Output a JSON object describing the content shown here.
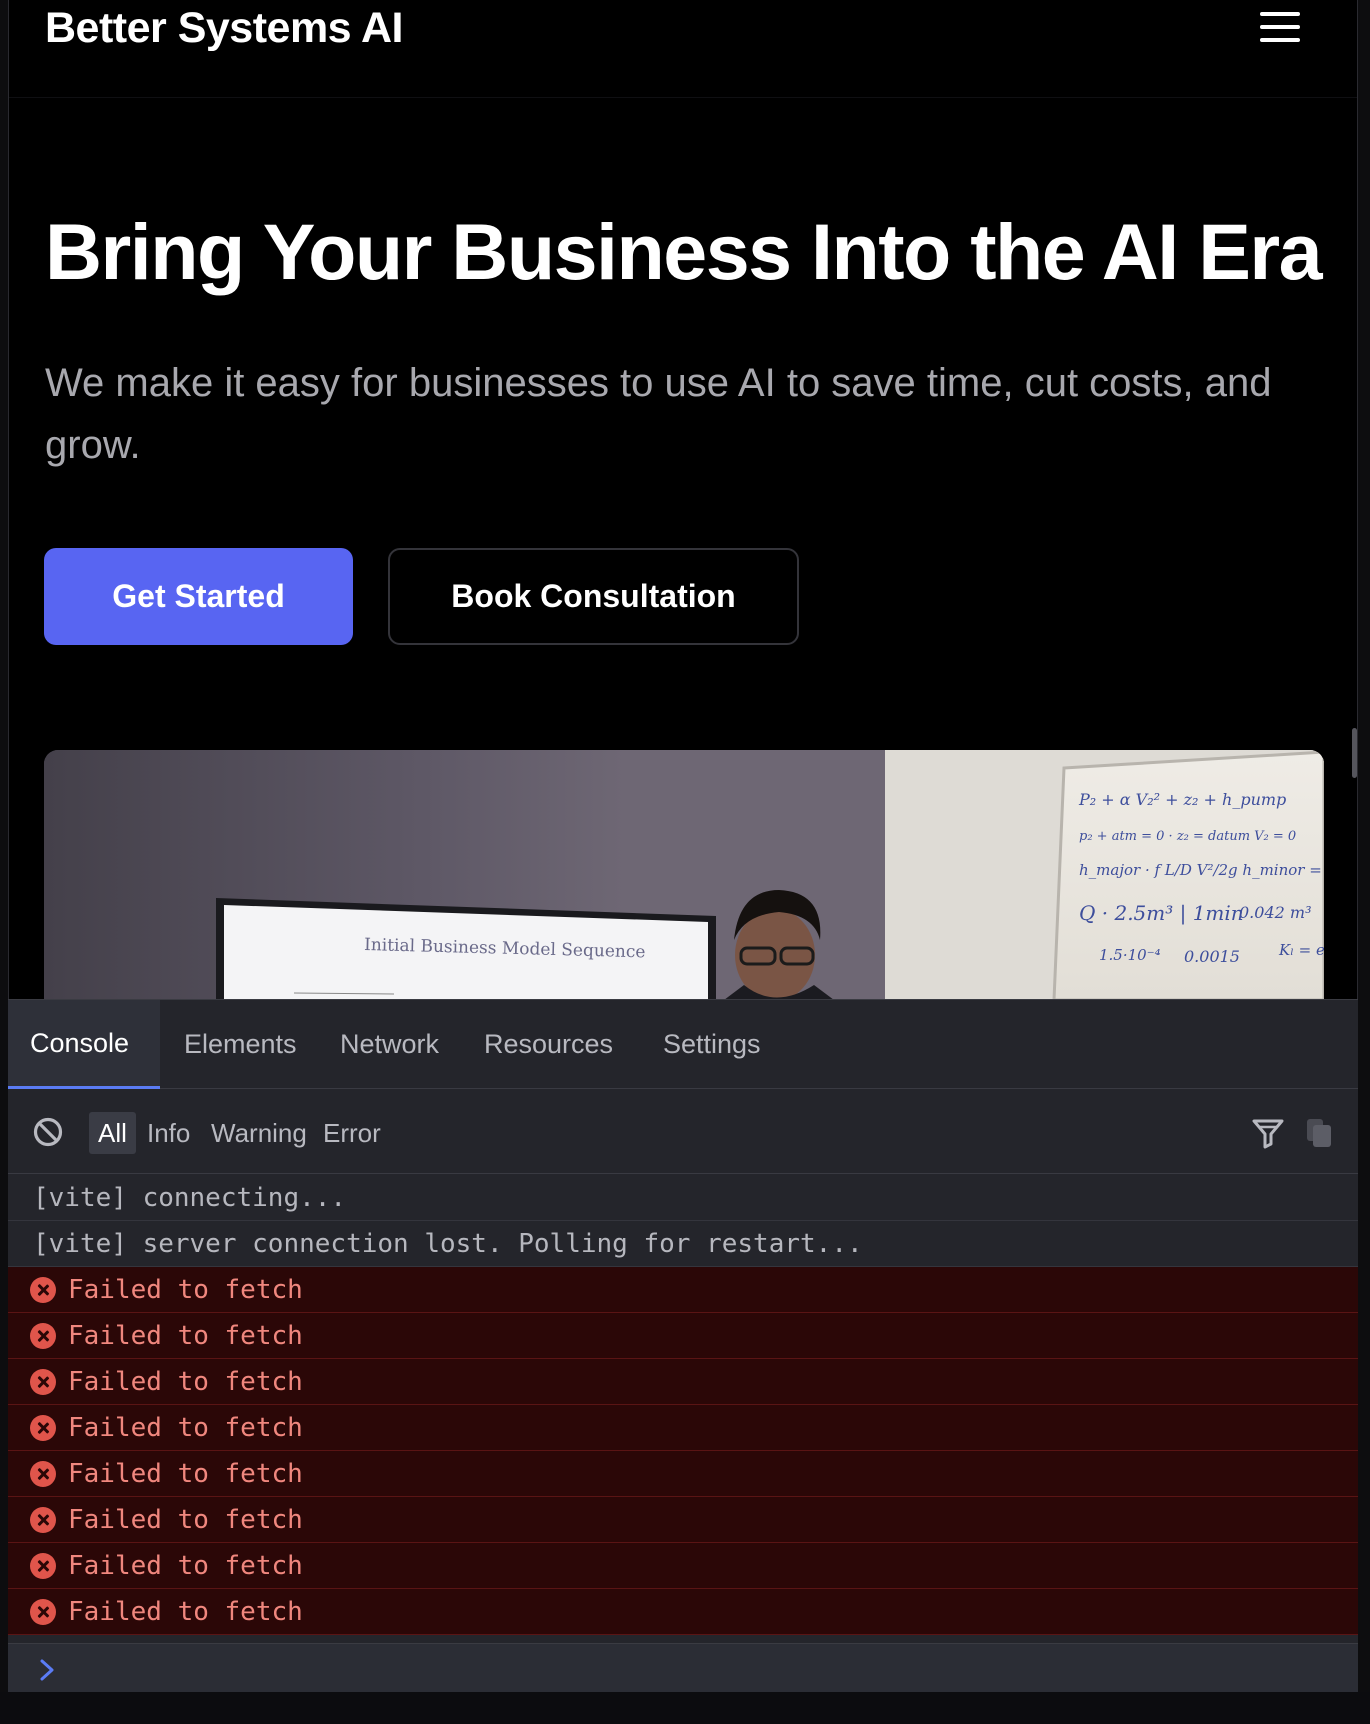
{
  "site": {
    "brand": "Better Systems AI",
    "menu_icon": "hamburger-icon"
  },
  "hero": {
    "title": "Bring Your Business Into the AI Era",
    "subtitle": "We make it easy for businesses to use AI to save time, cut costs, and grow.",
    "primary_button": "Get Started",
    "secondary_button": "Book Consultation",
    "accent_color": "#5865f2",
    "image": {
      "screen_text": "Initial Business Model Sequence",
      "whiteboard_text": [
        "0.042 m³",
        "0.0015",
        "1.5·10⁻⁴",
        "2.5m³"
      ]
    }
  },
  "devtools": {
    "tabs": [
      {
        "label": "Console",
        "active": true
      },
      {
        "label": "Elements",
        "active": false
      },
      {
        "label": "Network",
        "active": false
      },
      {
        "label": "Resources",
        "active": false
      },
      {
        "label": "Settings",
        "active": false
      }
    ],
    "filters": [
      {
        "label": "All",
        "active": true
      },
      {
        "label": "Info",
        "active": false
      },
      {
        "label": "Warning",
        "active": false
      },
      {
        "label": "Error",
        "active": false
      }
    ],
    "logs": [
      {
        "level": "info",
        "text": "[vite] connecting..."
      },
      {
        "level": "info",
        "text": "[vite] server connection lost. Polling for restart..."
      },
      {
        "level": "error",
        "text": "Failed to fetch"
      },
      {
        "level": "error",
        "text": "Failed to fetch"
      },
      {
        "level": "error",
        "text": "Failed to fetch"
      },
      {
        "level": "error",
        "text": "Failed to fetch"
      },
      {
        "level": "error",
        "text": "Failed to fetch"
      },
      {
        "level": "error",
        "text": "Failed to fetch"
      },
      {
        "level": "error",
        "text": "Failed to fetch"
      },
      {
        "level": "error",
        "text": "Failed to fetch"
      }
    ],
    "prompt_value": "",
    "icons": {
      "clear": "clear-console-icon",
      "filter": "filter-funnel-icon",
      "copy": "copy-icon",
      "error": "error-circle-icon",
      "prompt": "chevron-right-icon"
    },
    "colors": {
      "tab_underline": "#5b7cf5",
      "error_bg": "#2b0707",
      "error_text": "#f0877e"
    }
  }
}
